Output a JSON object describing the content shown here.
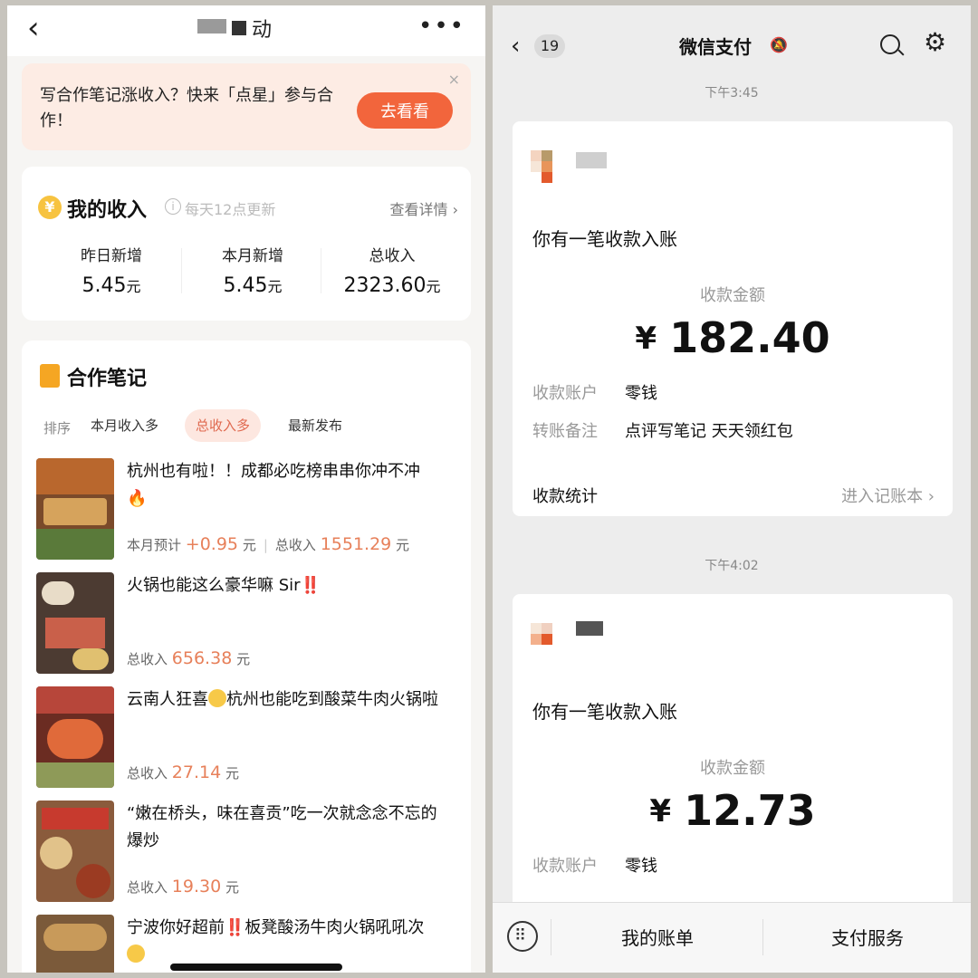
{
  "left": {
    "header": {
      "back_icon": "chevron-left-icon",
      "title_suffix": "动",
      "more_icon": "more-horizontal-icon"
    },
    "banner": {
      "text": "写合作笔记涨收入？快来「点星」参与合作！",
      "button": "去看看",
      "close": "×"
    },
    "income": {
      "icon": "¥",
      "title": "我的收入",
      "info": "i",
      "subtitle": "每天12点更新",
      "detail_link": "查看详情 ›",
      "stats": [
        {
          "label": "昨日新增",
          "value": "5.45",
          "unit": "元"
        },
        {
          "label": "本月新增",
          "value": "5.45",
          "unit": "元"
        },
        {
          "label": "总收入",
          "value": "2323.60",
          "unit": "元"
        }
      ]
    },
    "notes": {
      "title": "合作笔记",
      "sort_label": "排序",
      "sort_tabs": [
        "本月收入多",
        "总收入多",
        "最新发布"
      ],
      "items": [
        {
          "title": "杭州也有啦！！成都必吃榜串串你冲不冲",
          "emoji": "🔥",
          "meta1_label": "本月预计",
          "meta1_value": "+0.95",
          "meta1_unit": "元",
          "meta2_label": "总收入",
          "meta2_value": "1551.29",
          "meta2_unit": "元"
        },
        {
          "title": "火锅也能这么豪华嘛 Sir",
          "emoji": "‼️",
          "meta2_label": "总收入",
          "meta2_value": "656.38",
          "meta2_unit": "元"
        },
        {
          "title_a": "云南人狂喜",
          "title_b": "杭州也能吃到酸菜牛肉火锅啦",
          "meta2_label": "总收入",
          "meta2_value": "27.14",
          "meta2_unit": "元"
        },
        {
          "title": "“嫩在桥头，味在喜贡”吃一次就念念不忘的爆炒",
          "meta2_label": "总收入",
          "meta2_value": "19.30",
          "meta2_unit": "元"
        },
        {
          "title_a": "宁波你好超前",
          "title_b": "板凳酸汤牛肉火锅吼吼次",
          "emoji": "‼️"
        }
      ]
    }
  },
  "right": {
    "header": {
      "back_icon": "chevron-left-icon",
      "badge": "19",
      "title": "微信支付",
      "bell_icon": "bell-muted-icon",
      "search_icon": "search-icon",
      "gear_icon": "gear-icon"
    },
    "messages": [
      {
        "time": "下午3:45",
        "title": "你有一笔收款入账",
        "amount_label": "收款金额",
        "currency": "¥",
        "amount": "182.40",
        "account_label": "收款账户",
        "account": "零钱",
        "remark_label": "转账备注",
        "remark": "点评写笔记 天天领红包",
        "stats_label": "收款统计",
        "stats_link": "进入记账本 ›"
      },
      {
        "time": "下午4:02",
        "title": "你有一笔收款入账",
        "amount_label": "收款金额",
        "currency": "¥",
        "amount": "12.73",
        "account_label": "收款账户",
        "account": "零钱"
      }
    ],
    "tabbar": {
      "keyboard_icon": "keyboard-icon",
      "tabs": [
        "我的账单",
        "支付服务"
      ]
    }
  }
}
